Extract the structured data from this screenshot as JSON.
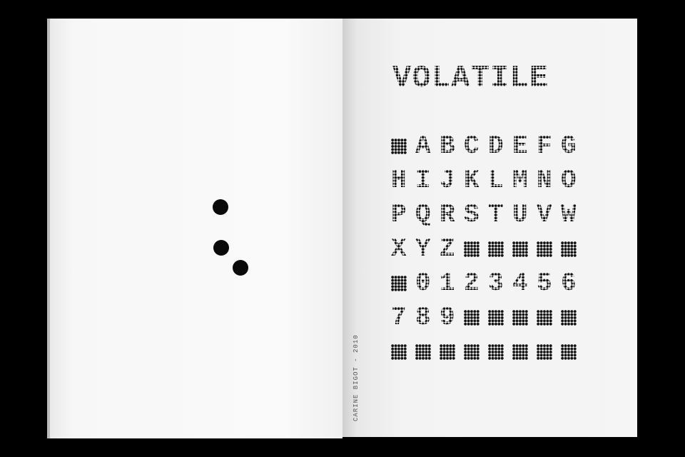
{
  "title": "VOLATILE",
  "specimen_rows": [
    [
      "■",
      "A",
      "B",
      "C",
      "D",
      "E",
      "F",
      "G"
    ],
    [
      "H",
      "I",
      "J",
      "K",
      "L",
      "M",
      "N",
      "O"
    ],
    [
      "P",
      "Q",
      "R",
      "S",
      "T",
      "U",
      "V",
      "W"
    ],
    [
      "X",
      "Y",
      "Z",
      "■",
      "■",
      "■",
      "■",
      "■"
    ],
    [
      "■",
      "0",
      "1",
      "2",
      "3",
      "4",
      "5",
      "6"
    ],
    [
      "7",
      "8",
      "9",
      "■",
      "■",
      "■",
      "■",
      "■"
    ],
    [
      "■",
      "■",
      "■",
      "■",
      "■",
      "■",
      "■",
      "■"
    ]
  ],
  "spine_credit": "CARINE BIGOT - 2010",
  "colors": {
    "background": "#000000",
    "paper": "#f5f5f5",
    "ink": "#111111"
  }
}
